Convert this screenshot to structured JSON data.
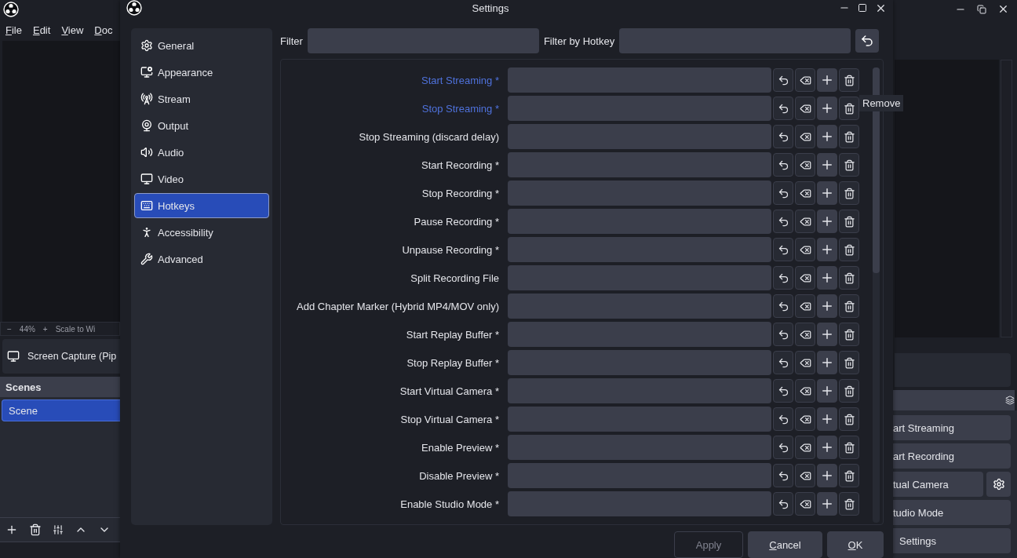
{
  "main_window": {
    "menu": [
      "File",
      "Edit",
      "View",
      "Doc"
    ],
    "zoom_bar": {
      "zoom_out": "−",
      "zoom": "44%",
      "zoom_in": "+",
      "scale": "Scale to Wi"
    },
    "source": {
      "name": "Screen Capture (Pip"
    },
    "scenes": {
      "title": "Scenes",
      "items": [
        {
          "name": "Scene",
          "selected": true
        }
      ]
    },
    "controls": [
      {
        "label": "art Streaming",
        "kind": "button"
      },
      {
        "label": "art Recording",
        "kind": "button"
      },
      {
        "label": "tual Camera",
        "kind": "with_settings"
      },
      {
        "label": "tudio Mode",
        "kind": "button"
      },
      {
        "label": "Settings",
        "kind": "button"
      }
    ]
  },
  "settings": {
    "title": "Settings",
    "sidebar": [
      {
        "label": "General",
        "selected": false
      },
      {
        "label": "Appearance",
        "selected": false
      },
      {
        "label": "Stream",
        "selected": false
      },
      {
        "label": "Output",
        "selected": false
      },
      {
        "label": "Audio",
        "selected": false
      },
      {
        "label": "Video",
        "selected": false
      },
      {
        "label": "Hotkeys",
        "selected": true
      },
      {
        "label": "Accessibility",
        "selected": false
      },
      {
        "label": "Advanced",
        "selected": false
      }
    ],
    "filter": {
      "label": "Filter"
    },
    "hotkey_filter": {
      "label": "Filter by Hotkey"
    },
    "hotkeys": [
      {
        "label": "Start Streaming *",
        "highlighted": true
      },
      {
        "label": "Stop Streaming *",
        "highlighted": true
      },
      {
        "label": "Stop Streaming (discard delay)",
        "highlighted": false
      },
      {
        "label": "Start Recording *",
        "highlighted": false
      },
      {
        "label": "Stop Recording *",
        "highlighted": false
      },
      {
        "label": "Pause Recording *",
        "highlighted": false
      },
      {
        "label": "Unpause Recording *",
        "highlighted": false
      },
      {
        "label": "Split Recording File",
        "highlighted": false
      },
      {
        "label": "Add Chapter Marker (Hybrid MP4/MOV only)",
        "highlighted": false
      },
      {
        "label": "Start Replay Buffer *",
        "highlighted": false
      },
      {
        "label": "Stop Replay Buffer *",
        "highlighted": false
      },
      {
        "label": "Start Virtual Camera *",
        "highlighted": false
      },
      {
        "label": "Stop Virtual Camera *",
        "highlighted": false
      },
      {
        "label": "Enable Preview *",
        "highlighted": false
      },
      {
        "label": "Disable Preview *",
        "highlighted": false
      },
      {
        "label": "Enable Studio Mode *",
        "highlighted": false
      }
    ],
    "tooltip": "Remove",
    "buttons": [
      {
        "label": "Apply",
        "disabled": true
      },
      {
        "label": "Cancel",
        "disabled": false
      },
      {
        "label": "OK",
        "disabled": false
      }
    ]
  }
}
